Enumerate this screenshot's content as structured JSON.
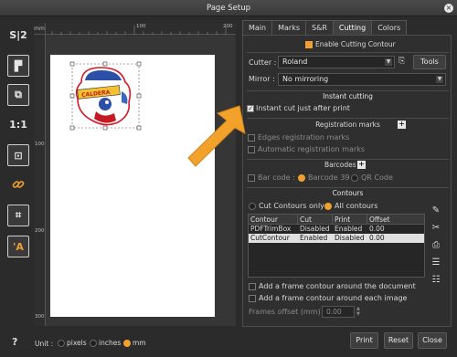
{
  "window": {
    "title": "Page Setup"
  },
  "toolbar": {
    "buttons": [
      {
        "name": "size-icon",
        "glyph": "S|2"
      },
      {
        "name": "align-icon",
        "glyph": "▛"
      },
      {
        "name": "export-icon",
        "glyph": "⧉"
      },
      {
        "name": "one-to-one-icon",
        "glyph": "1:1"
      },
      {
        "name": "fit-page-icon",
        "glyph": "⊡"
      },
      {
        "name": "link-icon",
        "glyph": "🔗"
      },
      {
        "name": "center-icon",
        "glyph": "⌗"
      },
      {
        "name": "text-a-icon",
        "glyph": "'A"
      }
    ]
  },
  "preview": {
    "ruler_unit": "mm",
    "ruler_top_labels": [
      "100",
      "200"
    ],
    "ruler_left_labels": [
      "100",
      "200",
      "300"
    ]
  },
  "tabs": [
    "Main",
    "Marks",
    "S&R",
    "Cutting",
    "Colors"
  ],
  "active_tab": "Cutting",
  "cutting": {
    "enable_label": "Enable Cutting Contour",
    "cutter_label": "Cutter :",
    "cutter_value": "Roland",
    "tools_label": "Tools",
    "mirror_label": "Mirror :",
    "mirror_value": "No mirroring"
  },
  "instant_cutting": {
    "header": "Instant cutting",
    "option_label": "Instant cut just after print"
  },
  "registration_marks": {
    "header": "Registration marks",
    "edges_label": "Edges registration marks",
    "automatic_label": "Automatic registration marks"
  },
  "barcodes": {
    "header": "Barcodes",
    "barcode_label": "Bar code :",
    "option1": "Barcode 39",
    "option2": "QR Code"
  },
  "contours": {
    "header": "Contours",
    "radio1": "Cut Contours only",
    "radio2": "All contours",
    "columns": [
      "Contour",
      "Cut",
      "Print",
      "Offset"
    ],
    "rows": [
      [
        "PDFTrimBox",
        "Disabled",
        "Enabled",
        "0.00"
      ],
      [
        "CutContour",
        "Enabled",
        "Disabled",
        "0.00"
      ]
    ],
    "frame_document_label": "Add a frame contour around the document",
    "frame_image_label": "Add a frame contour around each image",
    "frames_offset_label": "Frames offset (mm) :",
    "frames_offset_value": "0.00"
  },
  "bottom": {
    "help": "?",
    "unit_label": "Unit :",
    "units": [
      "pixels",
      "inches",
      "mm"
    ],
    "selected_unit": "mm",
    "print_label": "Print",
    "reset_label": "Reset",
    "close_label": "Close"
  },
  "colors": {
    "accent": "#f0a030",
    "panel": "#2f2f2f",
    "arrow": "#f2a22a"
  }
}
